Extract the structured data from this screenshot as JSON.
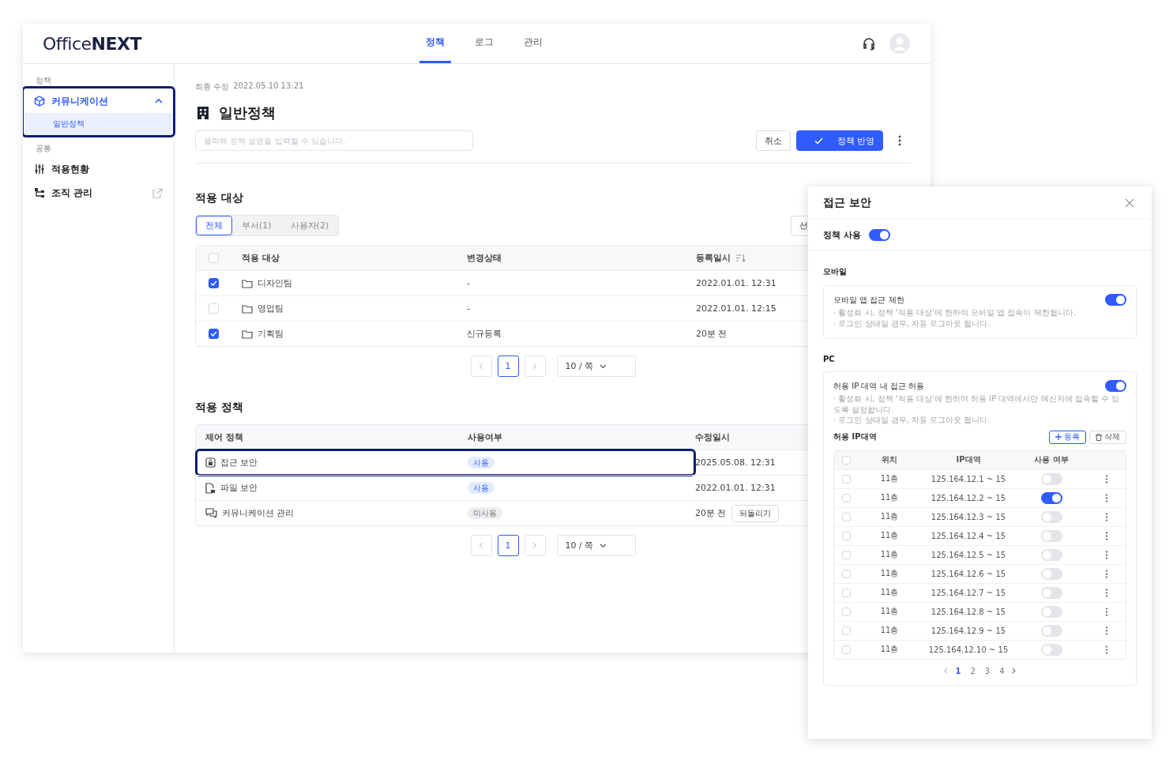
{
  "logo": "Office**NEXT**",
  "nav": [
    {
      "label": "정책",
      "selected": true
    },
    {
      "label": "로그",
      "selected": false
    },
    {
      "label": "관리",
      "selected": false
    }
  ],
  "sidebar": {
    "groups": [
      {
        "label": "정책",
        "items": [
          {
            "label": "커뮤니케이션",
            "expanded": true,
            "highlighted": true,
            "children": [
              {
                "label": "일반정책",
                "selected": true
              }
            ]
          }
        ]
      },
      {
        "label": "공통",
        "items": [
          {
            "label": "적용현황",
            "external": false
          },
          {
            "label": "조직 관리",
            "external": true
          }
        ]
      }
    ]
  },
  "policy": {
    "modified_label": "최종 수정",
    "modified": "2022.05.10 13:21",
    "title": "일반정책",
    "description_placeholder": "클릭해 정책 설명을 입력할 수 있습니다.",
    "buttons": {
      "cancel": "취소",
      "apply": "정책 반영"
    }
  },
  "targets": {
    "title": "적용 대상",
    "filters": [
      {
        "label": "전체",
        "selected": true
      },
      {
        "label": "부서(1)",
        "selected": false
      },
      {
        "label": "사용자(2)",
        "selected": false
      }
    ],
    "action": "선",
    "all_checked": false,
    "columns": [
      "적용 대상",
      "변경상태",
      "등록일시"
    ],
    "rows": [
      {
        "checked": true,
        "name": "디자인팀",
        "status": "-",
        "date": "2022.01.01. 12:31"
      },
      {
        "checked": false,
        "name": "영업팀",
        "status": "-",
        "date": "2022.01.01. 12:15"
      },
      {
        "checked": true,
        "name": "기획팀",
        "status": "신규등록",
        "date": "20분 전"
      }
    ],
    "pagination": {
      "page": "1",
      "page_size": "10 / 쪽"
    }
  },
  "policies": {
    "title": "적용 정책",
    "columns": [
      "제어 정책",
      "사용여부",
      "수정일시"
    ],
    "rows": [
      {
        "name": "접근 보안",
        "usage": "사용",
        "in_use": true,
        "date": "2025.05.08. 12:31",
        "highlighted": true
      },
      {
        "name": "파일 보안",
        "usage": "사용",
        "in_use": true,
        "date": "2022.01.01. 12:31"
      },
      {
        "name": "커뮤니케이션 관리",
        "usage": "미사용",
        "in_use": false,
        "date": "20분 전",
        "action": "되돌리기"
      }
    ],
    "pagination": {
      "page": "1",
      "page_size": "10 / 쪽"
    }
  },
  "panel": {
    "title": "접근 보안",
    "enable_label": "정책 사용",
    "enabled": true,
    "mobile": {
      "heading": "모바일",
      "title": "모바일 앱 접근 제한",
      "on": true,
      "notes": [
        "· 활성화 시, 정책 '적용 대상'에 한하여 모바일 앱 접속이 제한됩니다.",
        "· 로그인 상태일 경우, 자동 로그아웃 됩니다."
      ]
    },
    "pc": {
      "heading": "PC",
      "title": "허용 IP 대역 내 접근 허용",
      "on": true,
      "notes": [
        "· 활성화 시, 정책 '적용 대상'에 한하여 허용 IP 대역에서만 메신저에 접속할 수 있도록 설정합니다.",
        "· 로그인 상태일 경우, 자동 로그아웃 됩니다."
      ],
      "ip_title": "허용 IP대역",
      "all_checked": false,
      "add": "등록",
      "delete": "삭제",
      "columns": [
        "위치",
        "IP대역",
        "사용 여부"
      ],
      "rows": [
        {
          "checked": false,
          "location": "11층",
          "range": "125.164.12.1 ~ 15",
          "on": false
        },
        {
          "checked": false,
          "location": "11층",
          "range": "125.164.12.2 ~ 15",
          "on": true
        },
        {
          "checked": false,
          "location": "11층",
          "range": "125.164.12.3 ~ 15",
          "on": false
        },
        {
          "checked": false,
          "location": "11층",
          "range": "125.164.12.4 ~ 15",
          "on": false
        },
        {
          "checked": false,
          "location": "11층",
          "range": "125.164.12.5 ~ 15",
          "on": false
        },
        {
          "checked": false,
          "location": "11층",
          "range": "125.164.12.6 ~ 15",
          "on": false
        },
        {
          "checked": false,
          "location": "11층",
          "range": "125.164.12.7 ~ 15",
          "on": false
        },
        {
          "checked": false,
          "location": "11층",
          "range": "125.164.12.8 ~ 15",
          "on": false
        },
        {
          "checked": false,
          "location": "11층",
          "range": "125.164.12.9 ~ 15",
          "on": false
        },
        {
          "checked": false,
          "location": "11층",
          "range": "125.164.12.10 ~ 15",
          "on": false
        }
      ],
      "pages": [
        {
          "label": "1",
          "selected": true
        },
        {
          "label": "2",
          "selected": false
        },
        {
          "label": "3",
          "selected": false
        },
        {
          "label": "4",
          "selected": false
        }
      ]
    }
  }
}
